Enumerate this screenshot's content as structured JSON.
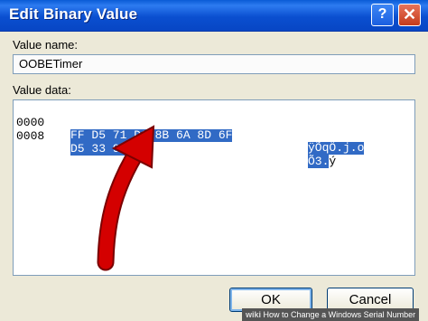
{
  "dialog": {
    "title": "Edit Binary Value",
    "help_glyph": "?",
    "close_glyph": "✕"
  },
  "value_name": {
    "label": "Value name:",
    "value": "OOBETimer"
  },
  "value_data": {
    "label": "Value data:",
    "rows": [
      {
        "address": "0000",
        "hex_selected": "FF D5 71 D6 8B 6A 8D 6F",
        "hex_unselected": "",
        "ascii": "ÿÕqÖ.j.o"
      },
      {
        "address": "0008",
        "hex_selected": "D5 33 93",
        "hex_unselected": " FD",
        "ascii_selected": "Õ3.",
        "ascii_unselected": "ý"
      }
    ]
  },
  "buttons": {
    "ok": "OK",
    "cancel": "Cancel"
  },
  "watermark": {
    "brand": "wiki",
    "text": "How to Change a Windows Serial Number"
  },
  "colors": {
    "titlebar": "#0a5bd6",
    "selection": "#316ac5",
    "annotation_arrow": "#d40000"
  },
  "icons": [
    "help-icon",
    "close-icon",
    "red-arrow-annotation"
  ]
}
